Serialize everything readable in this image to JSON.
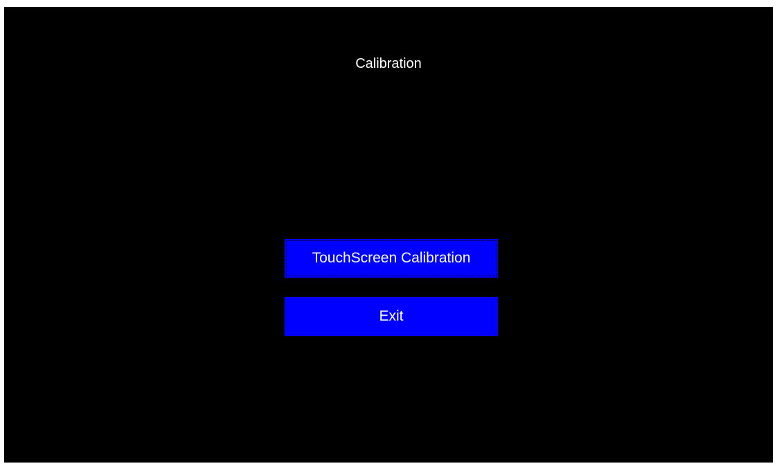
{
  "screen": {
    "title": "Calibration",
    "background_color": "#000000"
  },
  "buttons": {
    "touchscreen_calibration_label": "TouchScreen Calibration",
    "exit_label": "Exit",
    "color": "#0000ff",
    "focused": "touchscreen_calibration"
  }
}
